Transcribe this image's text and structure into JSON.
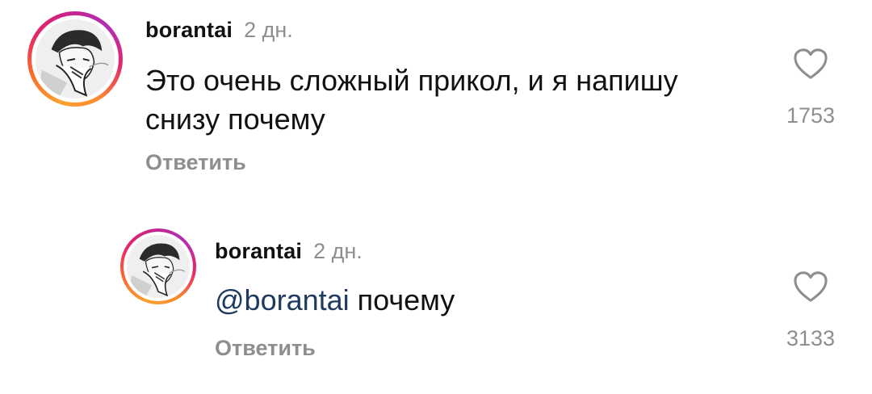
{
  "comments": [
    {
      "username": "borantai",
      "time": "2 дн.",
      "text": "Это очень сложный прикол, и я напишу снизу почему",
      "reply_label": "Ответить",
      "like_count": "1753"
    },
    {
      "username": "borantai",
      "time": "2 дн.",
      "mention": "@borantai",
      "text": " почему",
      "reply_label": "Ответить",
      "like_count": "3133"
    }
  ],
  "icons": {
    "like": "heart-outline-icon",
    "avatar": "user-avatar"
  },
  "colors": {
    "mention": "#1e3a60",
    "muted": "#8e8e8e",
    "ring_start": "#f9a12e",
    "ring_end": "#c6248b"
  }
}
